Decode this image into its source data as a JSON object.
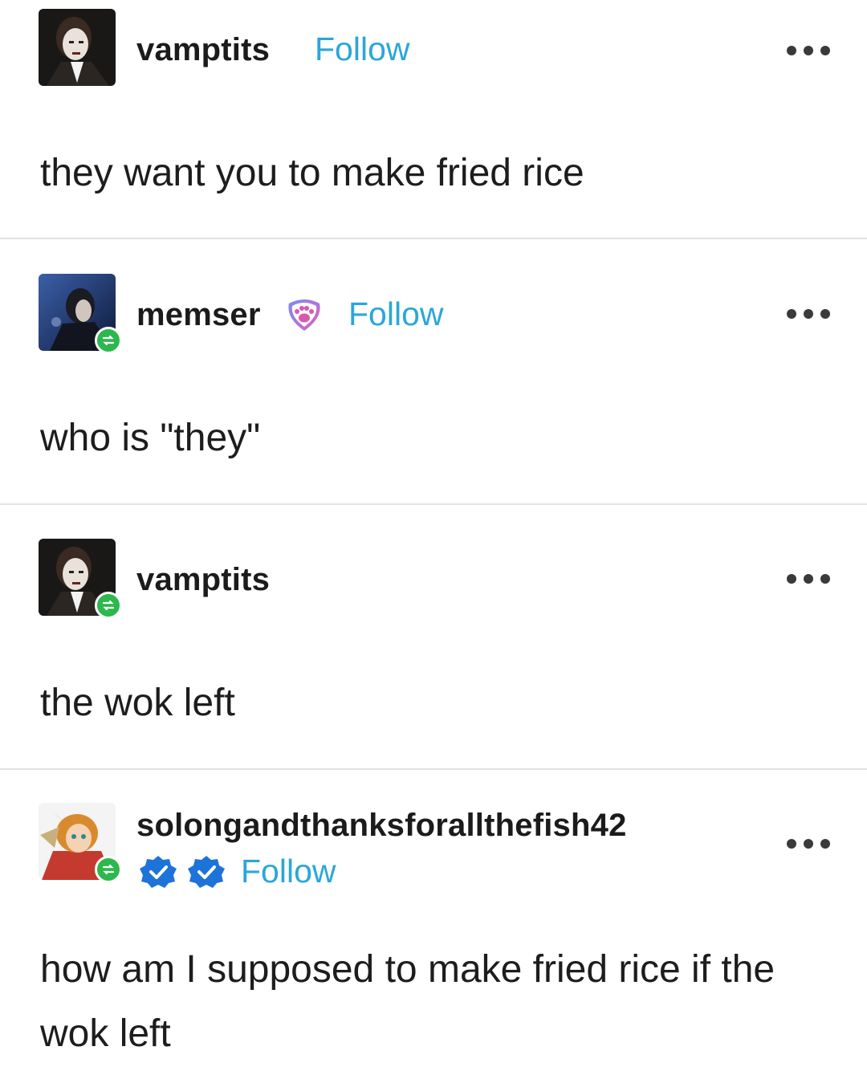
{
  "posts": [
    {
      "username": "vamptits",
      "follow_label": "Follow",
      "text": "they want you to make fried rice",
      "avatar_icon": "user-avatar",
      "reblogged": false
    },
    {
      "username": "memser",
      "follow_label": "Follow",
      "text": "who is \"they\"",
      "avatar_icon": "user-avatar",
      "badge_icon": "paw-badge-icon",
      "reblogged": true
    },
    {
      "username": "vamptits",
      "text": "the wok left",
      "avatar_icon": "user-avatar",
      "reblogged": true
    },
    {
      "username": "solongandthanksforallthefish42",
      "follow_label": "Follow",
      "text": "how am I supposed to make fried rice if the wok left",
      "avatar_icon": "user-avatar",
      "badge_icons": [
        "verified-badge-icon",
        "verified-badge-icon"
      ],
      "reblogged": true
    }
  ],
  "colors": {
    "follow": "#2aa7d8",
    "reblog_badge": "#2db84d",
    "verified_badge": "#1e73d8",
    "divider": "#e3e3e3"
  }
}
